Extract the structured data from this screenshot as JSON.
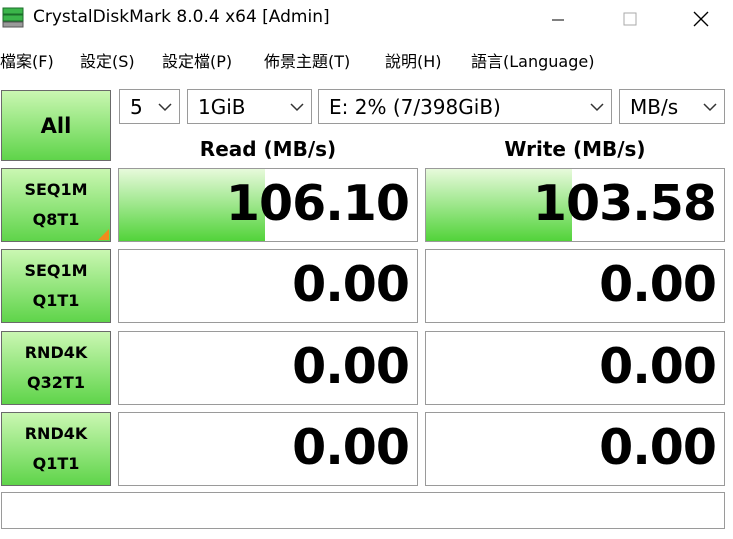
{
  "window": {
    "title": "CrystalDiskMark 8.0.4 x64 [Admin]"
  },
  "menu": [
    "檔案(F)",
    "設定(S)",
    "設定檔(P)",
    "佈景主題(T)",
    "說明(H)",
    "語言(Language)"
  ],
  "controls": {
    "all_label": "All",
    "count": "5",
    "size": "1GiB",
    "drive": "E: 2% (7/398GiB)",
    "unit": "MB/s"
  },
  "columns": {
    "read": "Read (MB/s)",
    "write": "Write (MB/s)"
  },
  "tests": [
    {
      "line1": "SEQ1M",
      "line2": "Q8T1",
      "read": "106.10",
      "write": "103.58",
      "read_fill": 0.49,
      "write_fill": 0.49
    },
    {
      "line1": "SEQ1M",
      "line2": "Q1T1",
      "read": "0.00",
      "write": "0.00",
      "read_fill": 0,
      "write_fill": 0
    },
    {
      "line1": "RND4K",
      "line2": "Q32T1",
      "read": "0.00",
      "write": "0.00",
      "read_fill": 0,
      "write_fill": 0
    },
    {
      "line1": "RND4K",
      "line2": "Q1T1",
      "read": "0.00",
      "write": "0.00",
      "read_fill": 0,
      "write_fill": 0
    }
  ],
  "comment": "",
  "colors": {
    "button_green": "#5fd44a",
    "fill_green": "#52d33a",
    "indicator_orange": "#f08c1c"
  },
  "icons": {
    "app": "crystaldiskmark-icon",
    "minimize": "minimize-icon",
    "maximize": "maximize-icon",
    "close": "close-icon",
    "dropdown": "chevron-down-icon"
  }
}
